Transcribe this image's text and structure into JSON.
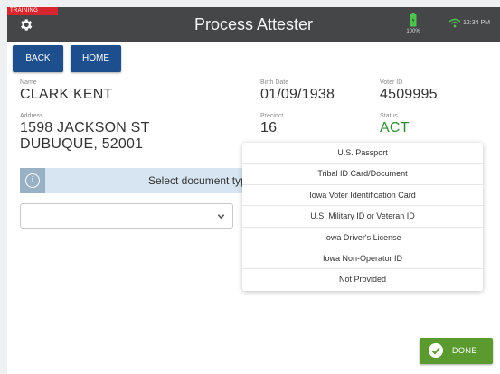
{
  "header": {
    "training_badge": "TRAINING",
    "title": "Process Attester",
    "battery_percent": "100%",
    "time": "12:34 PM",
    "icons": [
      "gear-icon",
      "battery-icon",
      "wifi-icon"
    ]
  },
  "nav": {
    "back_label": "BACK",
    "home_label": "HOME"
  },
  "voter": {
    "name_label": "Name",
    "name": "CLARK KENT",
    "birth_date_label": "Birth Date",
    "birth_date": "01/09/1938",
    "voter_id_label": "Voter ID",
    "voter_id": "4509995",
    "address_label": "Address",
    "address_line1": "1598 JACKSON ST",
    "address_line2": "DUBUQUE, 52001",
    "precinct_label": "Precinct",
    "precinct": "16",
    "status_label": "Status",
    "status": "ACT"
  },
  "document": {
    "prompt": "Select document typ",
    "selected_value": "",
    "options": [
      "U.S. Passport",
      "Tribal ID Card/Document",
      "Iowa Voter Identification Card",
      "U.S. Military ID or Veteran ID",
      "Iowa Driver's License",
      "Iowa Non-Operator ID",
      "Not Provided"
    ]
  },
  "done_label": "DONE",
  "colors": {
    "header_bg": "#444648",
    "nav_button": "#1d4f8f",
    "status_green": "#2e8b2e",
    "done_green": "#5a9a2f",
    "training_red": "#d7262e",
    "doc_bar": "#d7e5f2"
  }
}
